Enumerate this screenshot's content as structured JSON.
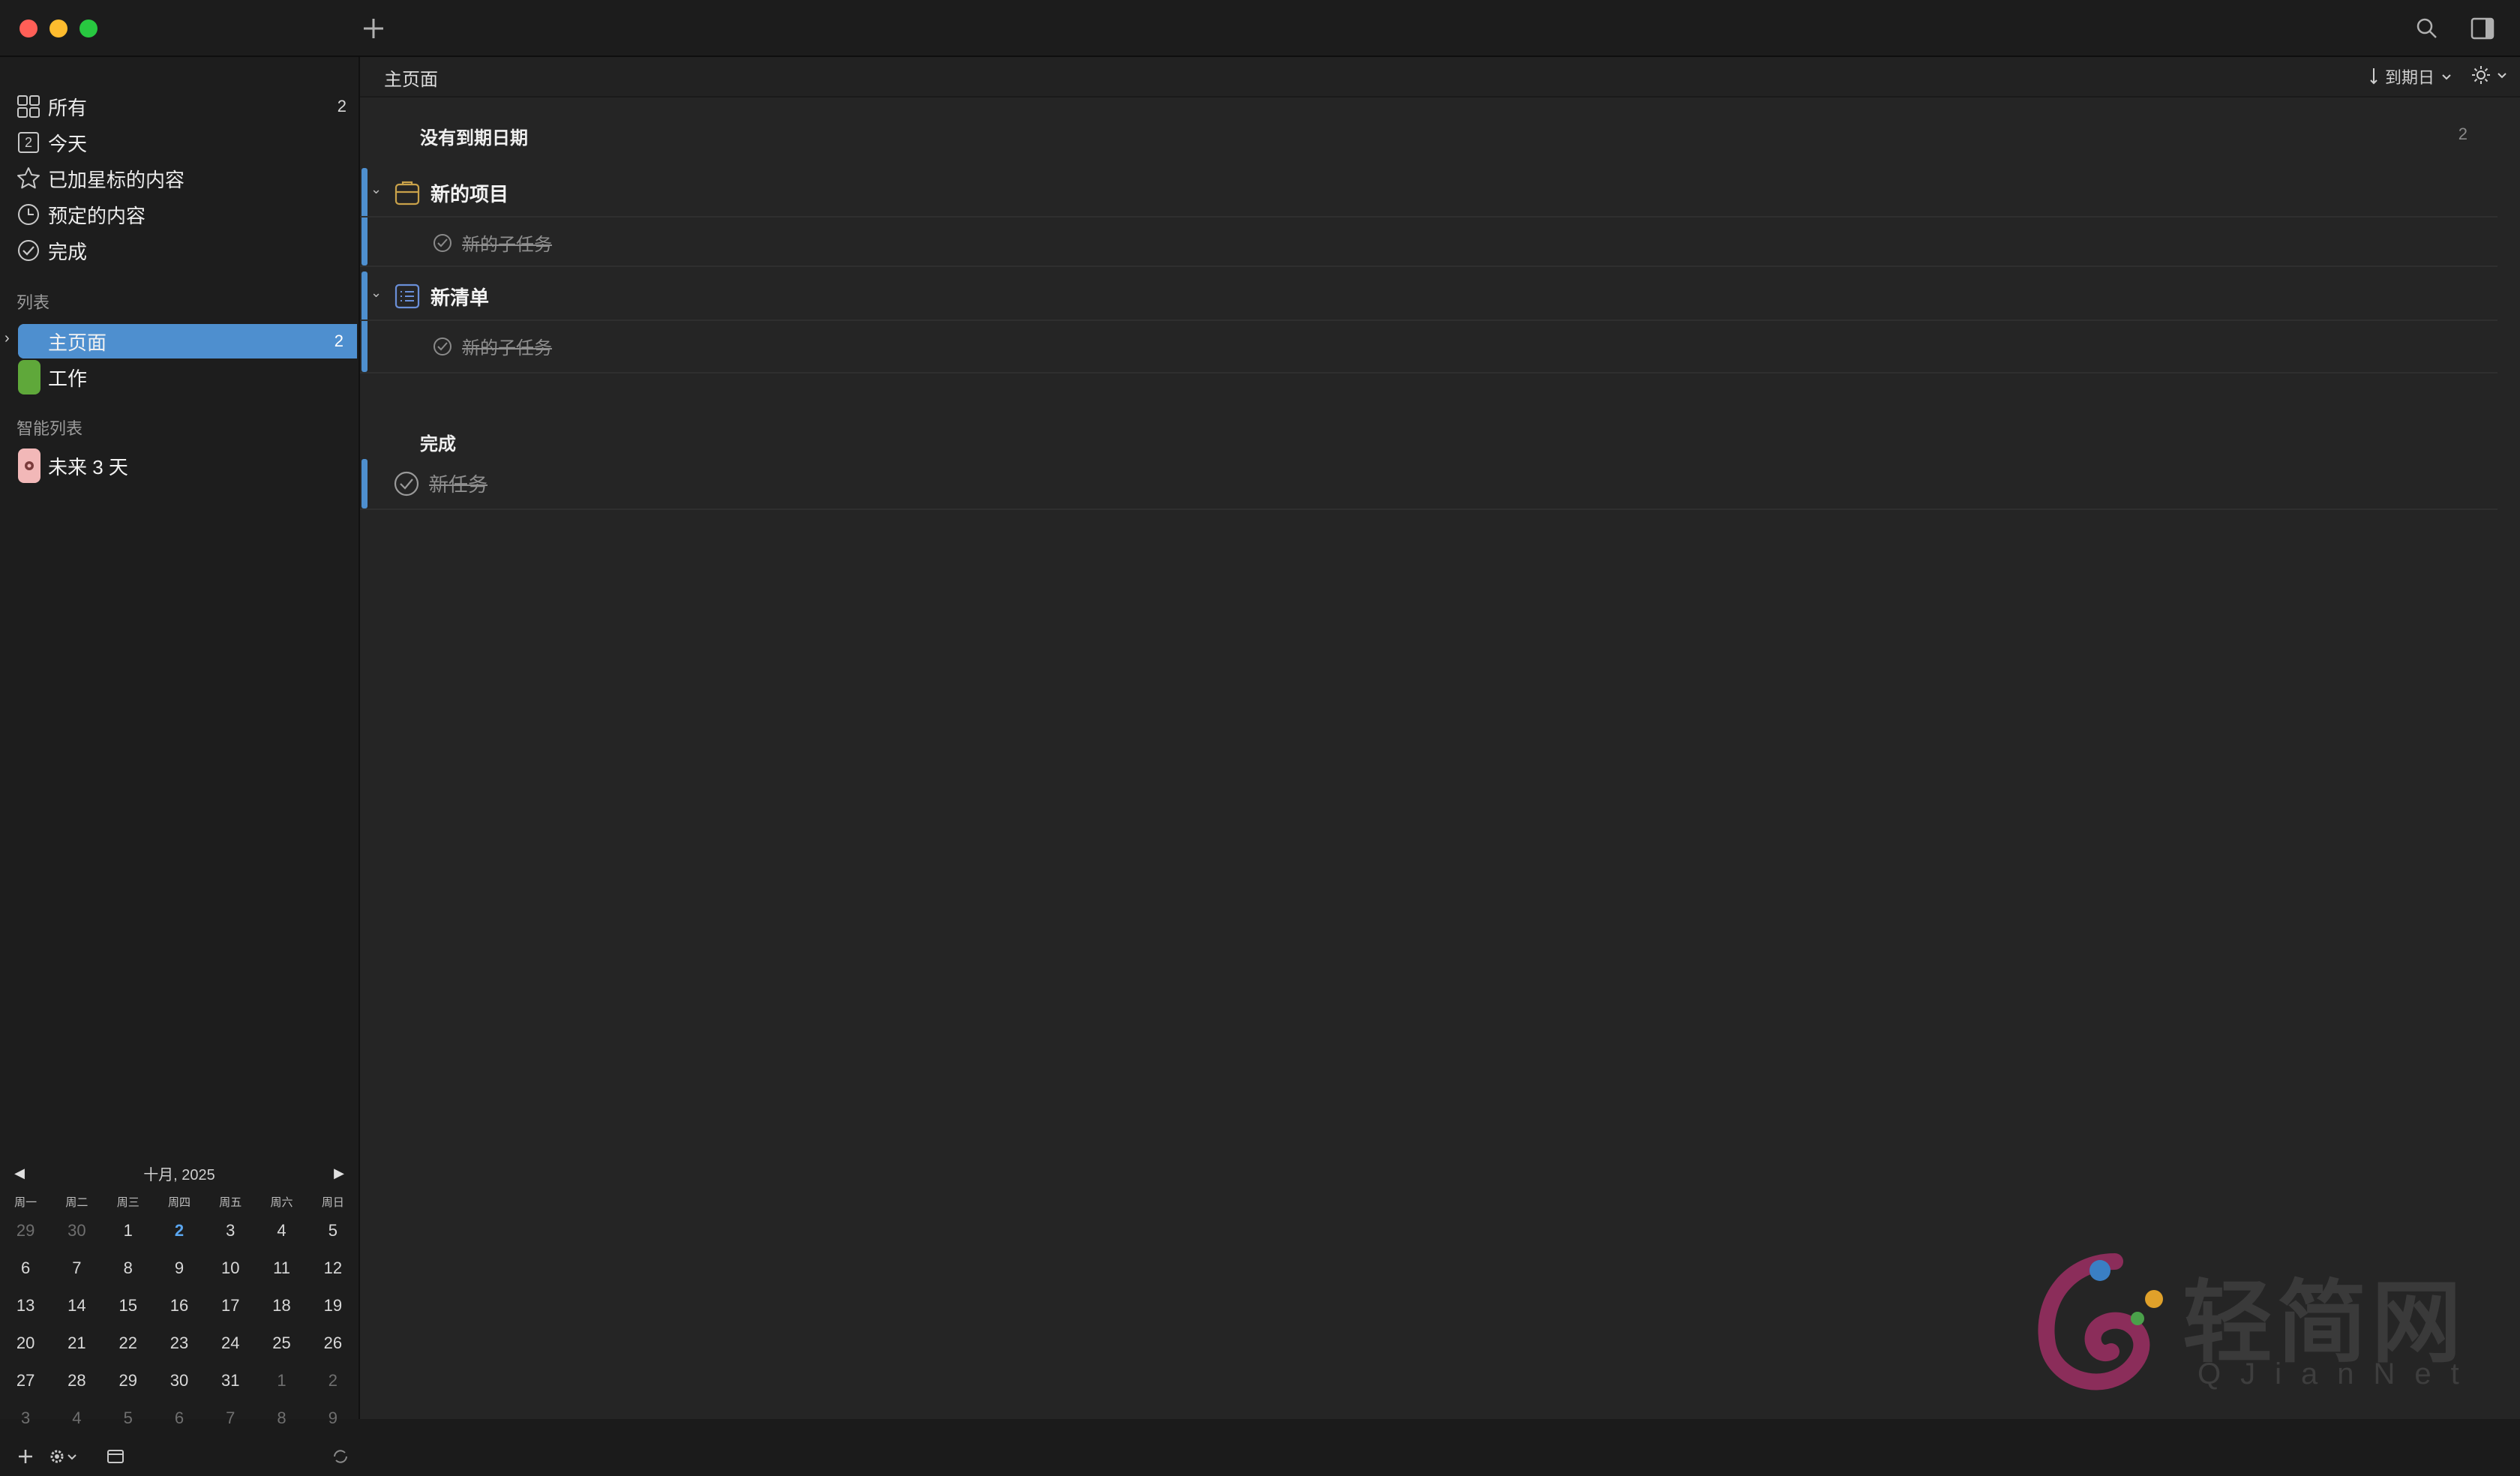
{
  "toolbar": {
    "add_icon": "plus-icon",
    "search_icon": "search-icon",
    "inspector_icon": "sidebar-right-icon"
  },
  "sidebar": {
    "smart_items": [
      {
        "label": "所有",
        "count": "2",
        "icon": "grid-icon"
      },
      {
        "label": "今天",
        "icon": "calendar-day-icon",
        "icon_text": "2"
      },
      {
        "label": "已加星标的内容",
        "icon": "star-icon"
      },
      {
        "label": "预定的内容",
        "icon": "clock-icon"
      },
      {
        "label": "完成",
        "icon": "check-circle-icon"
      }
    ],
    "lists_heading": "列表",
    "lists": [
      {
        "label": "主页面",
        "count": "2",
        "color": "#4e8fcf",
        "selected": true
      },
      {
        "label": "工作",
        "color": "#5fa83a"
      }
    ],
    "smart_lists_heading": "智能列表",
    "smart_lists": [
      {
        "label": "未来 3 天",
        "color": "#f2b8b8"
      }
    ]
  },
  "calendar": {
    "month_label": "十月, 2025",
    "weekdays": [
      "周一",
      "周二",
      "周三",
      "周四",
      "周五",
      "周六",
      "周日"
    ],
    "weeks": [
      [
        "29",
        "30",
        "1",
        "2",
        "3",
        "4",
        "5"
      ],
      [
        "6",
        "7",
        "8",
        "9",
        "10",
        "11",
        "12"
      ],
      [
        "13",
        "14",
        "15",
        "16",
        "17",
        "18",
        "19"
      ],
      [
        "20",
        "21",
        "22",
        "23",
        "24",
        "25",
        "26"
      ],
      [
        "27",
        "28",
        "29",
        "30",
        "31",
        "1",
        "2"
      ],
      [
        "3",
        "4",
        "5",
        "6",
        "7",
        "8",
        "9"
      ]
    ],
    "today": "2"
  },
  "main": {
    "breadcrumb": "主页面",
    "sort_label": "到期日",
    "groups": {
      "no_due_title": "没有到期日期",
      "no_due_count": "2",
      "project_label": "新的项目",
      "project_subtask": "新的子任务",
      "checklist_label": "新清单",
      "checklist_subtask": "新的子任务",
      "done_title": "完成",
      "done_task": "新任务"
    }
  },
  "watermark": {
    "text": "轻简网",
    "sub": "QJianNet"
  },
  "colors": {
    "accent": "#4e8fcf",
    "work": "#5fa83a"
  }
}
